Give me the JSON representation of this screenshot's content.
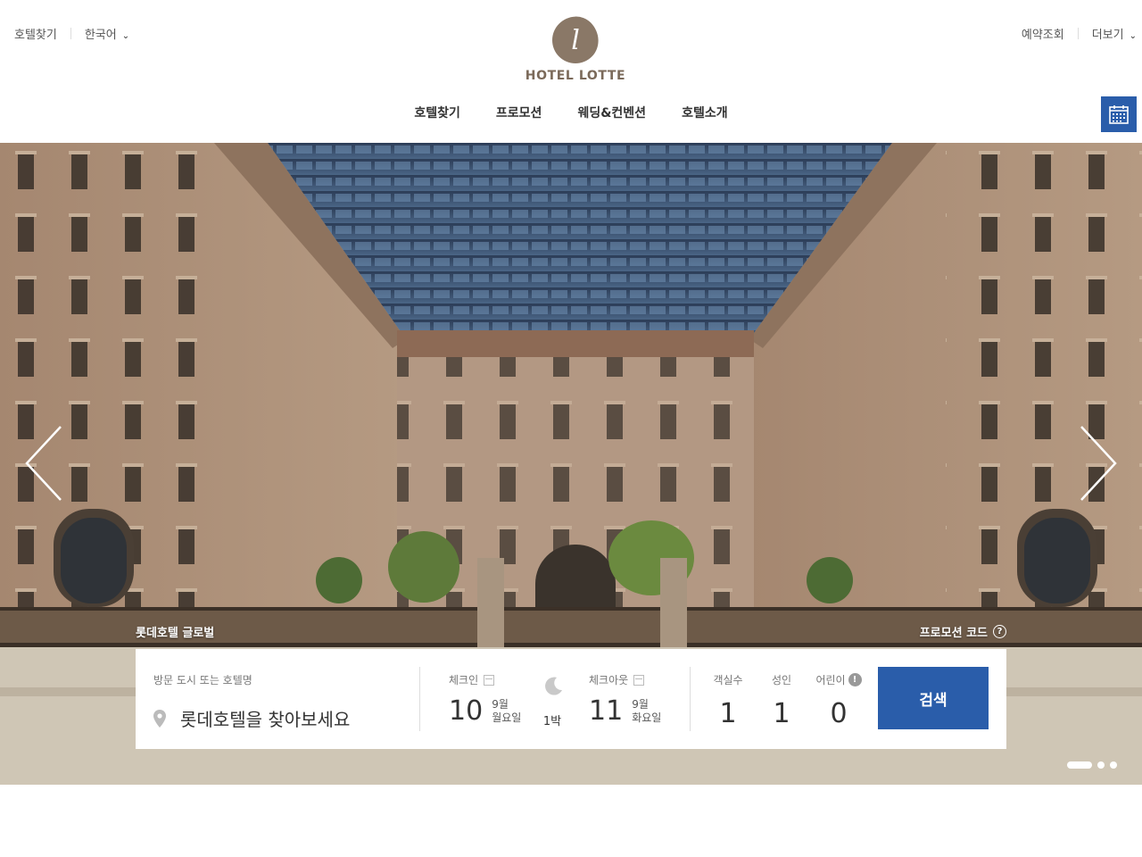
{
  "header": {
    "util_left": {
      "find_hotel": "호텔찾기",
      "language": "한국어"
    },
    "util_right": {
      "reservation_lookup": "예약조회",
      "more": "더보기"
    },
    "logo": {
      "mark": "l",
      "text": "HOTEL LOTTE"
    },
    "nav": [
      "호텔찾기",
      "프로모션",
      "웨딩&컨벤션",
      "호텔소개"
    ]
  },
  "hero": {
    "brand_label": "롯데호텔 글로벌",
    "promo_code_label": "프로모션 코드",
    "promo_help": "?"
  },
  "booking": {
    "destination": {
      "label": "방문 도시 또는 호텔명",
      "placeholder": "롯데호텔을 찾아보세요"
    },
    "checkin": {
      "label": "체크인",
      "day": "10",
      "month": "9월",
      "weekday": "월요일"
    },
    "nights": "1박",
    "checkout": {
      "label": "체크아웃",
      "day": "11",
      "month": "9월",
      "weekday": "화요일"
    },
    "rooms": {
      "label": "객실수",
      "value": "1"
    },
    "adults": {
      "label": "성인",
      "value": "1"
    },
    "children": {
      "label": "어린이",
      "value": "0",
      "info": "!"
    },
    "search_label": "검색"
  },
  "colors": {
    "brand": "#8a7867",
    "accent": "#2a5daa"
  },
  "icons": [
    "chevron-down-icon",
    "calendar-icon",
    "arrow-left-icon",
    "arrow-right-icon",
    "location-pin-icon",
    "moon-icon",
    "help-icon",
    "info-icon"
  ]
}
